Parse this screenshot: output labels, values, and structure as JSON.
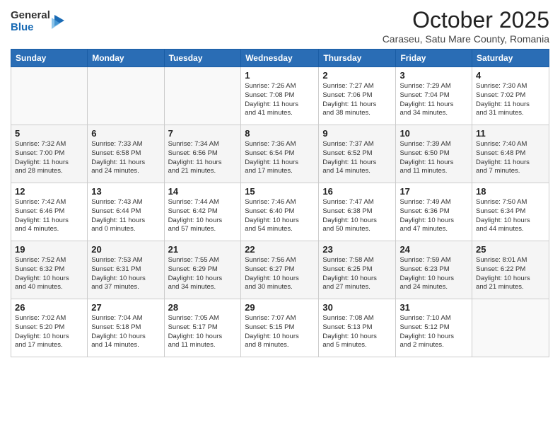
{
  "header": {
    "logo_general": "General",
    "logo_blue": "Blue",
    "title": "October 2025",
    "location": "Caraseu, Satu Mare County, Romania"
  },
  "days_of_week": [
    "Sunday",
    "Monday",
    "Tuesday",
    "Wednesday",
    "Thursday",
    "Friday",
    "Saturday"
  ],
  "weeks": [
    [
      {
        "day": "",
        "info": ""
      },
      {
        "day": "",
        "info": ""
      },
      {
        "day": "",
        "info": ""
      },
      {
        "day": "1",
        "info": "Sunrise: 7:26 AM\nSunset: 7:08 PM\nDaylight: 11 hours\nand 41 minutes."
      },
      {
        "day": "2",
        "info": "Sunrise: 7:27 AM\nSunset: 7:06 PM\nDaylight: 11 hours\nand 38 minutes."
      },
      {
        "day": "3",
        "info": "Sunrise: 7:29 AM\nSunset: 7:04 PM\nDaylight: 11 hours\nand 34 minutes."
      },
      {
        "day": "4",
        "info": "Sunrise: 7:30 AM\nSunset: 7:02 PM\nDaylight: 11 hours\nand 31 minutes."
      }
    ],
    [
      {
        "day": "5",
        "info": "Sunrise: 7:32 AM\nSunset: 7:00 PM\nDaylight: 11 hours\nand 28 minutes."
      },
      {
        "day": "6",
        "info": "Sunrise: 7:33 AM\nSunset: 6:58 PM\nDaylight: 11 hours\nand 24 minutes."
      },
      {
        "day": "7",
        "info": "Sunrise: 7:34 AM\nSunset: 6:56 PM\nDaylight: 11 hours\nand 21 minutes."
      },
      {
        "day": "8",
        "info": "Sunrise: 7:36 AM\nSunset: 6:54 PM\nDaylight: 11 hours\nand 17 minutes."
      },
      {
        "day": "9",
        "info": "Sunrise: 7:37 AM\nSunset: 6:52 PM\nDaylight: 11 hours\nand 14 minutes."
      },
      {
        "day": "10",
        "info": "Sunrise: 7:39 AM\nSunset: 6:50 PM\nDaylight: 11 hours\nand 11 minutes."
      },
      {
        "day": "11",
        "info": "Sunrise: 7:40 AM\nSunset: 6:48 PM\nDaylight: 11 hours\nand 7 minutes."
      }
    ],
    [
      {
        "day": "12",
        "info": "Sunrise: 7:42 AM\nSunset: 6:46 PM\nDaylight: 11 hours\nand 4 minutes."
      },
      {
        "day": "13",
        "info": "Sunrise: 7:43 AM\nSunset: 6:44 PM\nDaylight: 11 hours\nand 0 minutes."
      },
      {
        "day": "14",
        "info": "Sunrise: 7:44 AM\nSunset: 6:42 PM\nDaylight: 10 hours\nand 57 minutes."
      },
      {
        "day": "15",
        "info": "Sunrise: 7:46 AM\nSunset: 6:40 PM\nDaylight: 10 hours\nand 54 minutes."
      },
      {
        "day": "16",
        "info": "Sunrise: 7:47 AM\nSunset: 6:38 PM\nDaylight: 10 hours\nand 50 minutes."
      },
      {
        "day": "17",
        "info": "Sunrise: 7:49 AM\nSunset: 6:36 PM\nDaylight: 10 hours\nand 47 minutes."
      },
      {
        "day": "18",
        "info": "Sunrise: 7:50 AM\nSunset: 6:34 PM\nDaylight: 10 hours\nand 44 minutes."
      }
    ],
    [
      {
        "day": "19",
        "info": "Sunrise: 7:52 AM\nSunset: 6:32 PM\nDaylight: 10 hours\nand 40 minutes."
      },
      {
        "day": "20",
        "info": "Sunrise: 7:53 AM\nSunset: 6:31 PM\nDaylight: 10 hours\nand 37 minutes."
      },
      {
        "day": "21",
        "info": "Sunrise: 7:55 AM\nSunset: 6:29 PM\nDaylight: 10 hours\nand 34 minutes."
      },
      {
        "day": "22",
        "info": "Sunrise: 7:56 AM\nSunset: 6:27 PM\nDaylight: 10 hours\nand 30 minutes."
      },
      {
        "day": "23",
        "info": "Sunrise: 7:58 AM\nSunset: 6:25 PM\nDaylight: 10 hours\nand 27 minutes."
      },
      {
        "day": "24",
        "info": "Sunrise: 7:59 AM\nSunset: 6:23 PM\nDaylight: 10 hours\nand 24 minutes."
      },
      {
        "day": "25",
        "info": "Sunrise: 8:01 AM\nSunset: 6:22 PM\nDaylight: 10 hours\nand 21 minutes."
      }
    ],
    [
      {
        "day": "26",
        "info": "Sunrise: 7:02 AM\nSunset: 5:20 PM\nDaylight: 10 hours\nand 17 minutes."
      },
      {
        "day": "27",
        "info": "Sunrise: 7:04 AM\nSunset: 5:18 PM\nDaylight: 10 hours\nand 14 minutes."
      },
      {
        "day": "28",
        "info": "Sunrise: 7:05 AM\nSunset: 5:17 PM\nDaylight: 10 hours\nand 11 minutes."
      },
      {
        "day": "29",
        "info": "Sunrise: 7:07 AM\nSunset: 5:15 PM\nDaylight: 10 hours\nand 8 minutes."
      },
      {
        "day": "30",
        "info": "Sunrise: 7:08 AM\nSunset: 5:13 PM\nDaylight: 10 hours\nand 5 minutes."
      },
      {
        "day": "31",
        "info": "Sunrise: 7:10 AM\nSunset: 5:12 PM\nDaylight: 10 hours\nand 2 minutes."
      },
      {
        "day": "",
        "info": ""
      }
    ]
  ]
}
